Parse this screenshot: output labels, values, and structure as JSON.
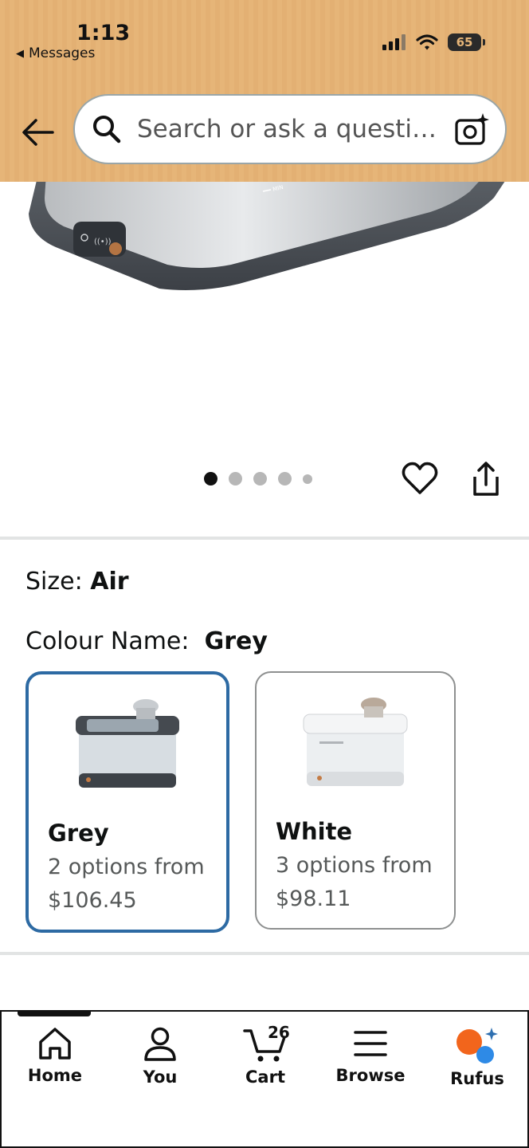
{
  "status_bar": {
    "time": "1:13",
    "back_app": "Messages",
    "battery": "65"
  },
  "search": {
    "placeholder": "Search or ask a questi…"
  },
  "gallery": {
    "total_images": 5,
    "active_index": 0
  },
  "product": {
    "size_label": "Size:",
    "size_value": "Air",
    "colour_label": "Colour Name:",
    "colour_value": "Grey"
  },
  "options": [
    {
      "name": "Grey",
      "offer": "2 options from",
      "price": "$106.45",
      "selected": true
    },
    {
      "name": "White",
      "offer": "3 options from",
      "price": "$98.11",
      "selected": false
    }
  ],
  "tabbar": {
    "home": "Home",
    "you": "You",
    "cart": "Cart",
    "cart_count": "26",
    "browse": "Browse",
    "rufus": "Rufus"
  },
  "colors": {
    "header_bg": "#e6b578",
    "selected_border": "#2d6aa3",
    "rufus_orange": "#f2651c",
    "rufus_blue": "#2e8ae6"
  }
}
